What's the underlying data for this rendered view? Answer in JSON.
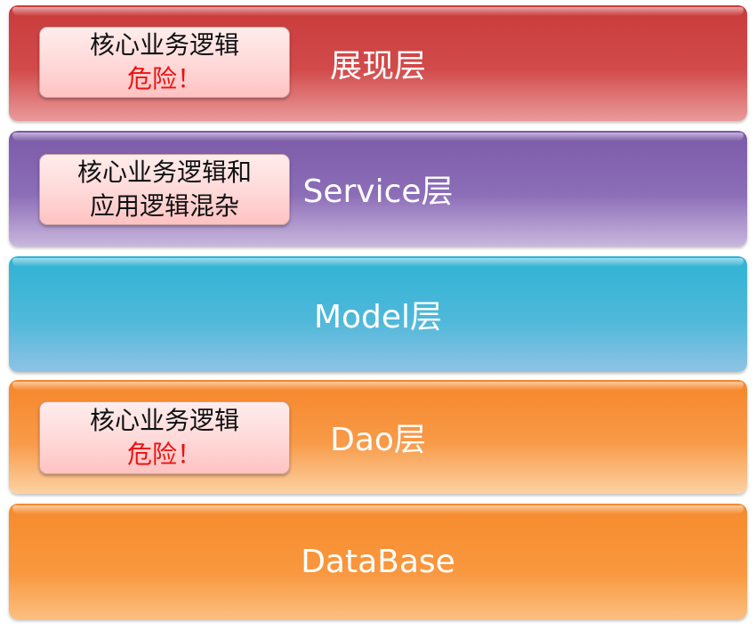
{
  "layers": [
    {
      "label": "展现层",
      "color": "#d24a4a",
      "note": {
        "line1": "核心业务逻辑",
        "line2": "危险！"
      }
    },
    {
      "label": "Service层",
      "color": "#8c6db7",
      "note": {
        "line1": "核心业务逻辑和",
        "line2": "应用逻辑混杂"
      }
    },
    {
      "label": "Model层",
      "color": "#4fb8da"
    },
    {
      "label": "Dao层",
      "color": "#f89a48",
      "note": {
        "line1": "核心业务逻辑",
        "line2": "危险！"
      }
    },
    {
      "label": "DataBase",
      "color": "#f9983f"
    }
  ],
  "warning_color": "#ee1111"
}
